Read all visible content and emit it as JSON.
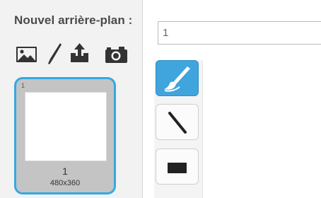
{
  "panel": {
    "title": "Nouvel arrière-plan :"
  },
  "new_backdrop_tools": [
    {
      "name": "paint-from-library",
      "icon": "image-icon"
    },
    {
      "name": "paint-new",
      "icon": "brush-icon"
    },
    {
      "name": "upload-from-file",
      "icon": "upload-icon"
    },
    {
      "name": "camera",
      "icon": "camera-icon"
    }
  ],
  "backdrops": [
    {
      "index": "1",
      "name": "1",
      "size": "480x360",
      "selected": true
    }
  ],
  "editor": {
    "name_value": "1"
  },
  "paint_tools": [
    {
      "icon": "brush-icon",
      "active": true
    },
    {
      "icon": "line-icon",
      "active": false
    },
    {
      "icon": "rectangle-icon",
      "active": false
    }
  ],
  "colors": {
    "accent": "#34a9e0",
    "active_tool": "#3fa5dc",
    "title_text": "#4a4a4a",
    "icon": "#333333"
  }
}
